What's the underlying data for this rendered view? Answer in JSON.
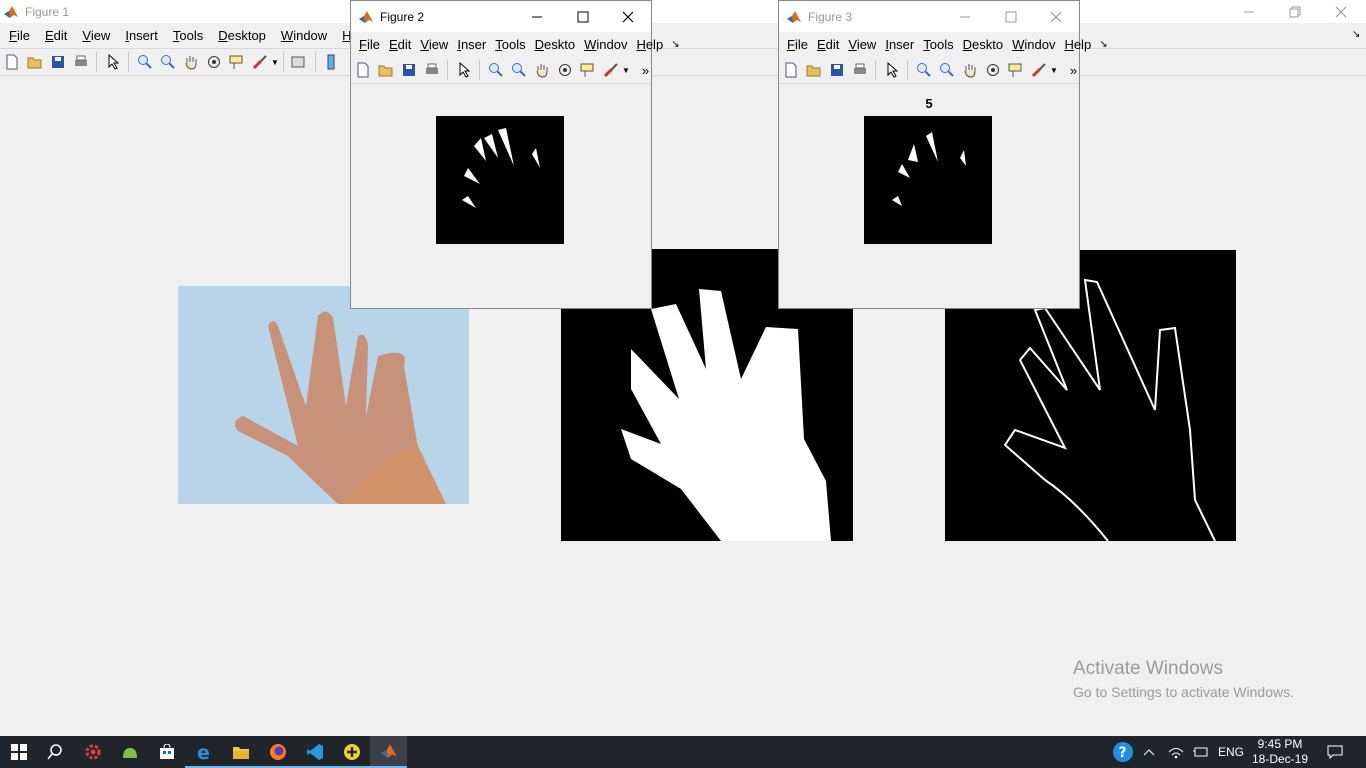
{
  "figure1": {
    "title": "Figure 1",
    "menu": [
      "File",
      "Edit",
      "View",
      "Insert",
      "Tools",
      "Desktop",
      "Window",
      "Hel"
    ]
  },
  "figure2": {
    "title": "Figure 2",
    "menu": [
      "File",
      "Edit",
      "View",
      "Inser",
      "Tools",
      "Deskto",
      "Windov",
      "Help"
    ]
  },
  "figure3": {
    "title": "Figure 3",
    "plot_title": "5",
    "menu": [
      "File",
      "Edit",
      "View",
      "Inser",
      "Tools",
      "Deskto",
      "Windov",
      "Help"
    ]
  },
  "watermark": {
    "line1": "Activate Windows",
    "line2": "Go to Settings to activate Windows."
  },
  "taskbar": {
    "lang": "ENG",
    "time": "9:45 PM",
    "date": "18-Dec-19"
  },
  "colors": {
    "taskbar": "#20242b",
    "accent": "#0078d7",
    "photo_bg": "#b8d4e8",
    "skin": "#c8917a"
  }
}
